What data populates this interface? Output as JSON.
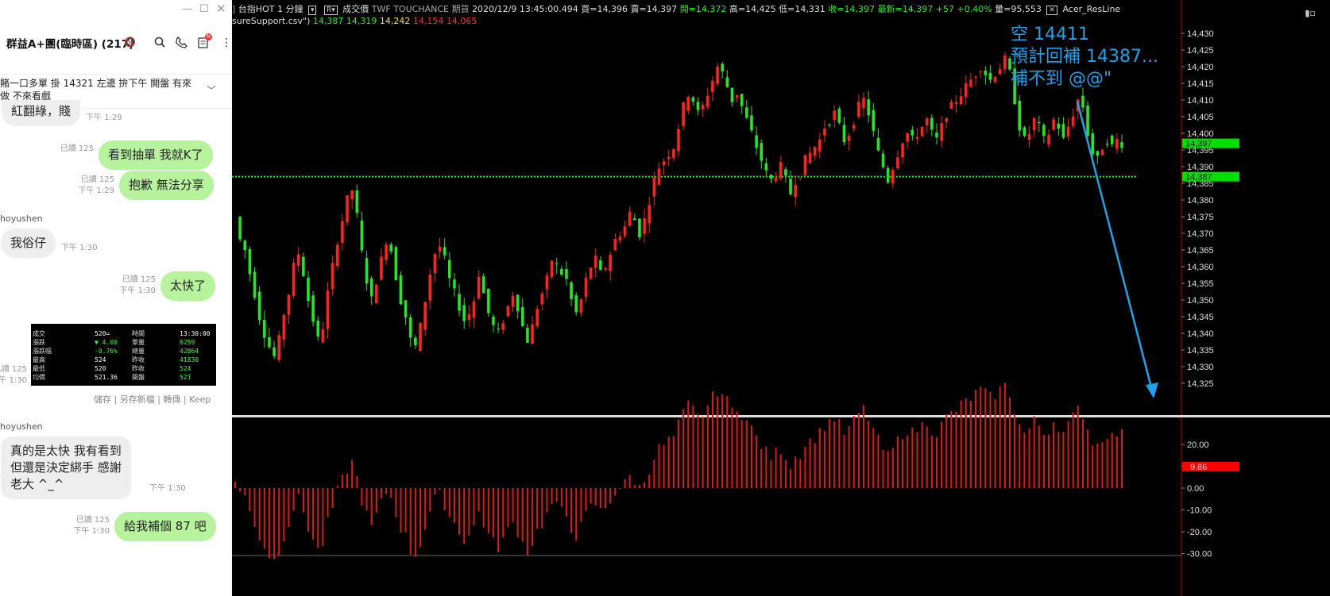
{
  "chat": {
    "group_title": "群益A+團(臨時區) (217)",
    "notice": "賭一口多單 掛 14321 左邊 拚下午 開盤 有來做 不來看戲",
    "badge": "N",
    "messages": [
      {
        "side": "them",
        "text": "紅翻綠，賤",
        "time": "下午 1:29"
      },
      {
        "side": "me",
        "text": "看到抽單 我就K了",
        "read": "已讀 125",
        "time": ""
      },
      {
        "side": "me",
        "text": "抱歉 無法分享",
        "read": "已讀 125",
        "time": "下午 1:29"
      },
      {
        "side": "them",
        "sender": "hoyushen",
        "text": "我俗仔",
        "time": "下午 1:30"
      },
      {
        "side": "me",
        "text": "太快了",
        "read": "已讀 125",
        "time": "下午 1:30"
      },
      {
        "side": "me",
        "type": "image",
        "read": "已讀 125",
        "time": "下午 1:30"
      },
      {
        "side": "them",
        "sender": "hoyushen",
        "text": "真的是太快 我有看到\n但還是決定綁手 感謝\n老大 ^_^",
        "time": "下午 1:30"
      },
      {
        "side": "me",
        "text": "給我補個 87 吧",
        "read": "已讀 125",
        "time": "下午 1:30"
      }
    ],
    "image_actions": [
      "儲存",
      "另存新檔",
      "轉傳",
      "Keep"
    ],
    "quote_image": {
      "rows": [
        [
          "成交",
          "520=",
          "時間",
          "13:30:00"
        ],
        [
          "漲跌",
          "▼ 4.00",
          "單量",
          "6259"
        ],
        [
          "漲跌幅",
          "-0.76%",
          "總量",
          "42864"
        ],
        [
          "最高",
          "524",
          "昨收",
          "41830"
        ],
        [
          "最低",
          "520",
          "昨收",
          "524"
        ],
        [
          "均價",
          "521.36",
          "開盤",
          "521"
        ]
      ]
    }
  },
  "toolbar": {
    "symbol": "台指HOT",
    "interval": "1 分鐘",
    "field": "成交價",
    "source": "TWF TOUCHANCE 期貨",
    "datetime": "2020/12/9  13:45:00.494",
    "bid": "買=14,396",
    "ask": "賣=14,397",
    "open": "開=14,372",
    "high": "高=14,425",
    "low": "低=14,331",
    "close": "收=14,397",
    "last": "最新=14,397",
    "change": "+57",
    "change_pct": "+0.40%",
    "volume": "量=95,553",
    "indicator": "Acer_ResLine",
    "line2_file": "sureSupport.csv\")",
    "line2_values": [
      "14,387",
      "14,319",
      "14,242",
      "14,154",
      "14,065"
    ]
  },
  "annotation": {
    "line1": "空 14411",
    "line2": "預計回補 14387...",
    "line3": "補不到 @@\""
  },
  "price_axis": {
    "ticks": [
      "14,430",
      "14,425",
      "14,420",
      "14,415",
      "14,410",
      "14,405",
      "14,400",
      "14,395",
      "14,390",
      "14,385",
      "14,380",
      "14,375",
      "14,370",
      "14,365",
      "14,360",
      "14,355",
      "14,350",
      "14,345",
      "14,340",
      "14,335",
      "14,330",
      "14,325"
    ],
    "last_tag": "14,397",
    "support_tag": "14,387",
    "last_color": "#00e000",
    "support_color": "#00e000"
  },
  "osc_axis": {
    "ticks": [
      "20.00",
      "10.00",
      "0.00",
      "-10.00",
      "-20.00",
      "-30.00"
    ],
    "last_tag": "9.86",
    "tag_color": "#ff0000"
  },
  "chart_data": {
    "type": "candlestick",
    "ylim": [
      14325,
      14430
    ],
    "support_line": 14387,
    "title": "",
    "candles_approx_path": [
      14375,
      14368,
      14365,
      14358,
      14352,
      14345,
      14340,
      14336,
      14333,
      14338,
      14346,
      14352,
      14360,
      14364,
      14358,
      14350,
      14344,
      14338,
      14342,
      14352,
      14360,
      14368,
      14374,
      14380,
      14383,
      14375,
      14364,
      14356,
      14350,
      14356,
      14362,
      14368,
      14365,
      14357,
      14350,
      14345,
      14338,
      14336,
      14342,
      14350,
      14358,
      14364,
      14366,
      14362,
      14356,
      14352,
      14348,
      14344,
      14346,
      14350,
      14358,
      14352,
      14346,
      14342,
      14340,
      14344,
      14348,
      14352,
      14348,
      14342,
      14338,
      14342,
      14348,
      14352,
      14356,
      14362,
      14360,
      14358,
      14356,
      14350,
      14346,
      14350,
      14356,
      14360,
      14362,
      14358,
      14360,
      14364,
      14368,
      14370,
      14372,
      14376,
      14374,
      14370,
      14374,
      14380,
      14386,
      14390,
      14392,
      14394,
      14396,
      14402,
      14408,
      14412,
      14410,
      14406,
      14408,
      14412,
      14416,
      14420,
      14418,
      14414,
      14410,
      14412,
      14408,
      14404,
      14400,
      14396,
      14392,
      14388,
      14386,
      14388,
      14390,
      14386,
      14382,
      14386,
      14388,
      14392,
      14394,
      14396,
      14398,
      14402,
      14404,
      14406,
      14402,
      14398,
      14400,
      14404,
      14408,
      14410,
      14406,
      14400,
      14394,
      14390,
      14386,
      14390,
      14394,
      14398,
      14400,
      14398,
      14400,
      14402,
      14404,
      14400,
      14398,
      14402,
      14406,
      14408,
      14410,
      14412,
      14414,
      14416,
      14418,
      14420,
      14418,
      14416,
      14418,
      14420,
      14422,
      14418,
      14410,
      14402,
      14398,
      14400,
      14404,
      14402,
      14398,
      14400,
      14404,
      14402,
      14398,
      14402,
      14406,
      14410,
      14408,
      14400,
      14394,
      14392,
      14396,
      14398,
      14396,
      14398,
      14397
    ]
  }
}
